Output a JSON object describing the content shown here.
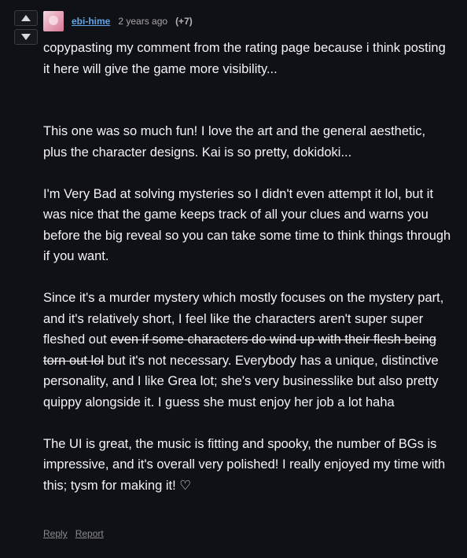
{
  "comment": {
    "author": "ebi-hime",
    "timestamp": "2 years ago",
    "score": "(+7)",
    "icons": {
      "upvote": "chevron-up-icon",
      "downvote": "chevron-down-icon"
    },
    "paragraphs": {
      "p1": "copypasting my comment from the rating page because i think posting it here will give the game more visibility...",
      "p2": "This one was so much fun! I love the art and the general aesthetic, plus the character designs. Kai is so pretty, dokidoki...",
      "p3": "I'm Very Bad at solving mysteries so I didn't even attempt it lol, but it was nice that the game keeps track of all your clues and warns you before the big reveal so you can take some time to think things through if you want.",
      "p4_before": "Since it's a murder mystery which mostly focuses on the mystery part, and it's relatively short, I feel like the characters aren't super super fleshed out ",
      "p4_strike": "even if some characters do wind up with their flesh being torn out lol",
      "p4_after": " but it's not necessary. Everybody has a unique, distinctive personality, and I like Grea lot; she's very businesslike but also pretty quippy alongside it. I guess she must enjoy her job a lot haha",
      "p5": "The UI is great, the music is fitting and spooky, the number of BGs is impressive, and it's overall very polished! I really enjoyed my time with this; tysm for making it! ♡"
    },
    "actions": {
      "reply": "Reply",
      "report": "Report"
    }
  },
  "colors": {
    "background": "#101117",
    "link": "#62a6e8",
    "text": "#f4f4f4",
    "muted": "#8c8c8c"
  }
}
